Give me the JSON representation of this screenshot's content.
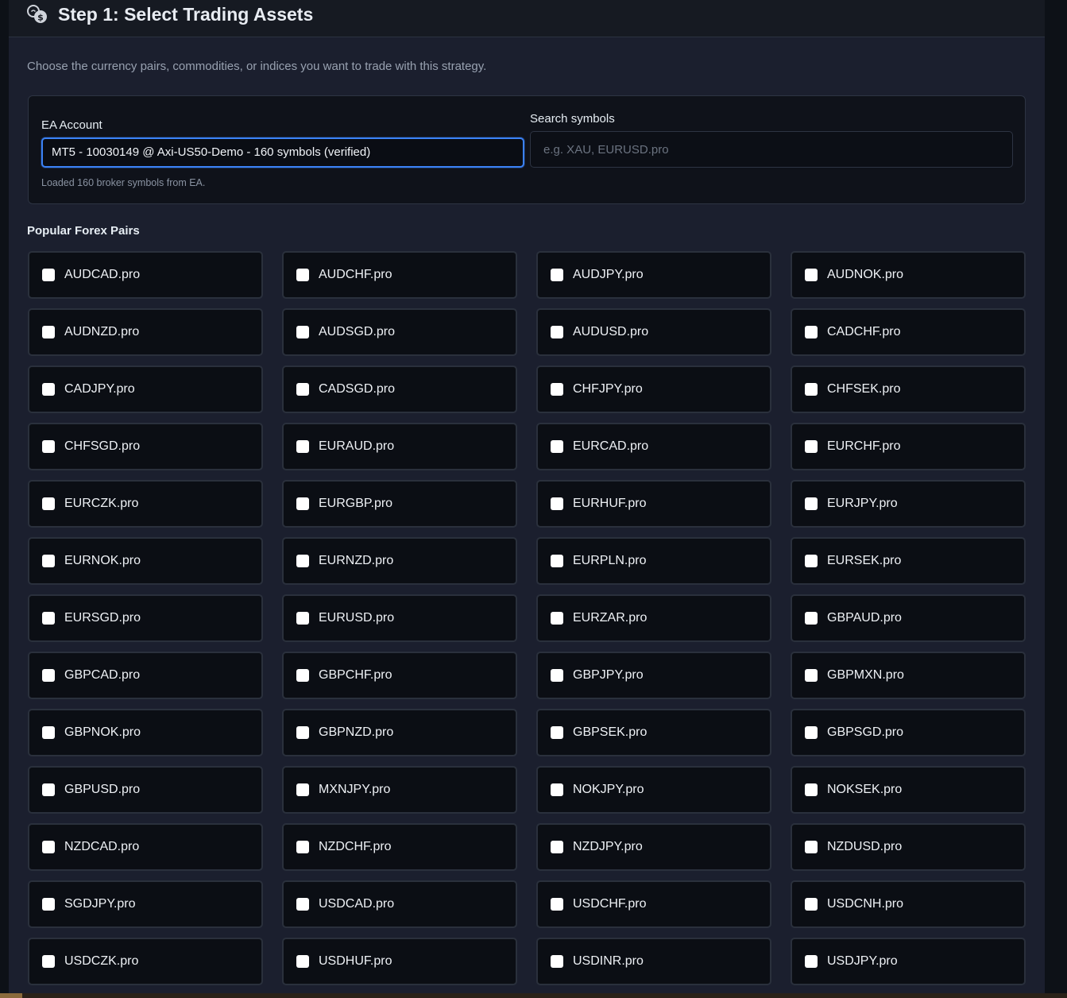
{
  "header": {
    "title": "Step 1: Select Trading Assets",
    "icon": "coins-icon"
  },
  "subtitle": "Choose the currency pairs, commodities, or indices you want to trade with this strategy.",
  "account": {
    "label": "EA Account",
    "selected": "MT5 - 10030149 @ Axi-US50-Demo - 160 symbols (verified)",
    "hint": "Loaded 160 broker symbols from EA."
  },
  "search": {
    "label": "Search symbols",
    "placeholder": "e.g. XAU, EURUSD.pro",
    "value": ""
  },
  "section_title": "Popular Forex Pairs",
  "symbols": [
    "AUDCAD.pro",
    "AUDCHF.pro",
    "AUDJPY.pro",
    "AUDNOK.pro",
    "AUDNZD.pro",
    "AUDSGD.pro",
    "AUDUSD.pro",
    "CADCHF.pro",
    "CADJPY.pro",
    "CADSGD.pro",
    "CHFJPY.pro",
    "CHFSEK.pro",
    "CHFSGD.pro",
    "EURAUD.pro",
    "EURCAD.pro",
    "EURCHF.pro",
    "EURCZK.pro",
    "EURGBP.pro",
    "EURHUF.pro",
    "EURJPY.pro",
    "EURNOK.pro",
    "EURNZD.pro",
    "EURPLN.pro",
    "EURSEK.pro",
    "EURSGD.pro",
    "EURUSD.pro",
    "EURZAR.pro",
    "GBPAUD.pro",
    "GBPCAD.pro",
    "GBPCHF.pro",
    "GBPJPY.pro",
    "GBPMXN.pro",
    "GBPNOK.pro",
    "GBPNZD.pro",
    "GBPSEK.pro",
    "GBPSGD.pro",
    "GBPUSD.pro",
    "MXNJPY.pro",
    "NOKJPY.pro",
    "NOKSEK.pro",
    "NZDCAD.pro",
    "NZDCHF.pro",
    "NZDJPY.pro",
    "NZDUSD.pro",
    "SGDJPY.pro",
    "USDCAD.pro",
    "USDCHF.pro",
    "USDCNH.pro",
    "USDCZK.pro",
    "USDHUF.pro",
    "USDINR.pro",
    "USDJPY.pro"
  ],
  "colors": {
    "accent": "#3b82f6",
    "background": "#1b1f2e"
  }
}
